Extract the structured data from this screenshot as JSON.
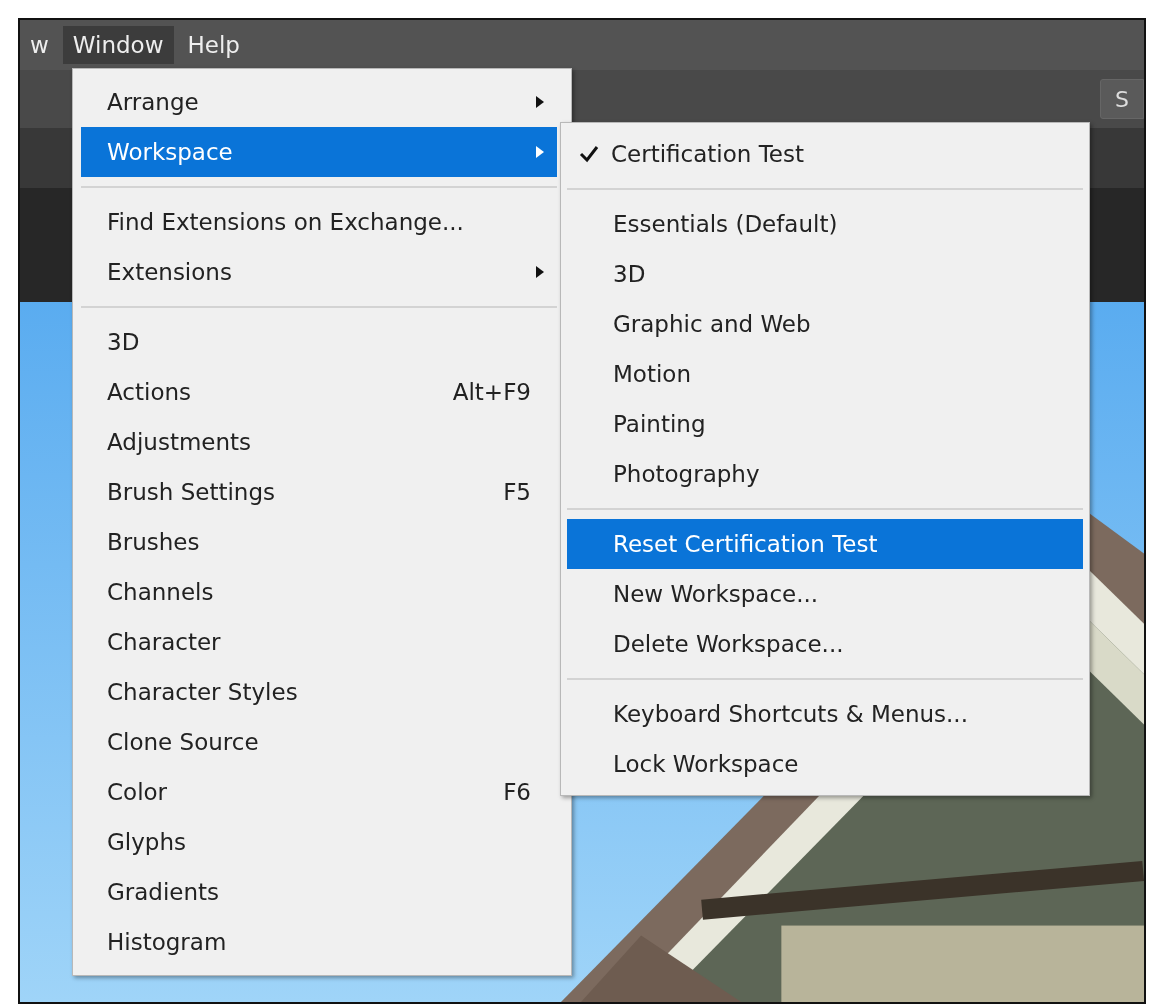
{
  "menu_bar": [
    {
      "label": "w",
      "selected": false
    },
    {
      "label": "Window",
      "selected": true
    },
    {
      "label": "Help",
      "selected": false
    }
  ],
  "toolbar": {
    "button": "S"
  },
  "window_menu": [
    {
      "kind": "item",
      "label": "Arrange",
      "submenu": true,
      "selected": false
    },
    {
      "kind": "item",
      "label": "Workspace",
      "submenu": true,
      "selected": true
    },
    {
      "kind": "separator"
    },
    {
      "kind": "item",
      "label": "Find Extensions on Exchange...",
      "submenu": false,
      "selected": false
    },
    {
      "kind": "item",
      "label": "Extensions",
      "submenu": true,
      "selected": false
    },
    {
      "kind": "separator"
    },
    {
      "kind": "item",
      "label": "3D",
      "submenu": false,
      "selected": false
    },
    {
      "kind": "item",
      "label": "Actions",
      "shortcut": "Alt+F9",
      "submenu": false,
      "selected": false
    },
    {
      "kind": "item",
      "label": "Adjustments",
      "submenu": false,
      "selected": false
    },
    {
      "kind": "item",
      "label": "Brush Settings",
      "shortcut": "F5",
      "submenu": false,
      "selected": false
    },
    {
      "kind": "item",
      "label": "Brushes",
      "submenu": false,
      "selected": false
    },
    {
      "kind": "item",
      "label": "Channels",
      "submenu": false,
      "selected": false
    },
    {
      "kind": "item",
      "label": "Character",
      "submenu": false,
      "selected": false
    },
    {
      "kind": "item",
      "label": "Character Styles",
      "submenu": false,
      "selected": false
    },
    {
      "kind": "item",
      "label": "Clone Source",
      "submenu": false,
      "selected": false
    },
    {
      "kind": "item",
      "label": "Color",
      "shortcut": "F6",
      "submenu": false,
      "selected": false
    },
    {
      "kind": "item",
      "label": "Glyphs",
      "submenu": false,
      "selected": false
    },
    {
      "kind": "item",
      "label": "Gradients",
      "submenu": false,
      "selected": false
    },
    {
      "kind": "item",
      "label": "Histogram",
      "submenu": false,
      "selected": false
    }
  ],
  "workspace_submenu": [
    {
      "kind": "item",
      "label": "Certification Test",
      "checked": true,
      "selected": false
    },
    {
      "kind": "separator"
    },
    {
      "kind": "item",
      "label": "Essentials (Default)",
      "checked": false,
      "selected": false
    },
    {
      "kind": "item",
      "label": "3D",
      "checked": false,
      "selected": false
    },
    {
      "kind": "item",
      "label": "Graphic and Web",
      "checked": false,
      "selected": false
    },
    {
      "kind": "item",
      "label": "Motion",
      "checked": false,
      "selected": false
    },
    {
      "kind": "item",
      "label": "Painting",
      "checked": false,
      "selected": false
    },
    {
      "kind": "item",
      "label": "Photography",
      "checked": false,
      "selected": false
    },
    {
      "kind": "separator"
    },
    {
      "kind": "item",
      "label": "Reset Certification Test",
      "checked": false,
      "selected": true
    },
    {
      "kind": "item",
      "label": "New Workspace...",
      "checked": false,
      "selected": false
    },
    {
      "kind": "item",
      "label": "Delete Workspace...",
      "checked": false,
      "selected": false
    },
    {
      "kind": "separator"
    },
    {
      "kind": "item",
      "label": "Keyboard Shortcuts & Menus...",
      "checked": false,
      "selected": false
    },
    {
      "kind": "item",
      "label": "Lock Workspace",
      "checked": false,
      "selected": false
    }
  ]
}
